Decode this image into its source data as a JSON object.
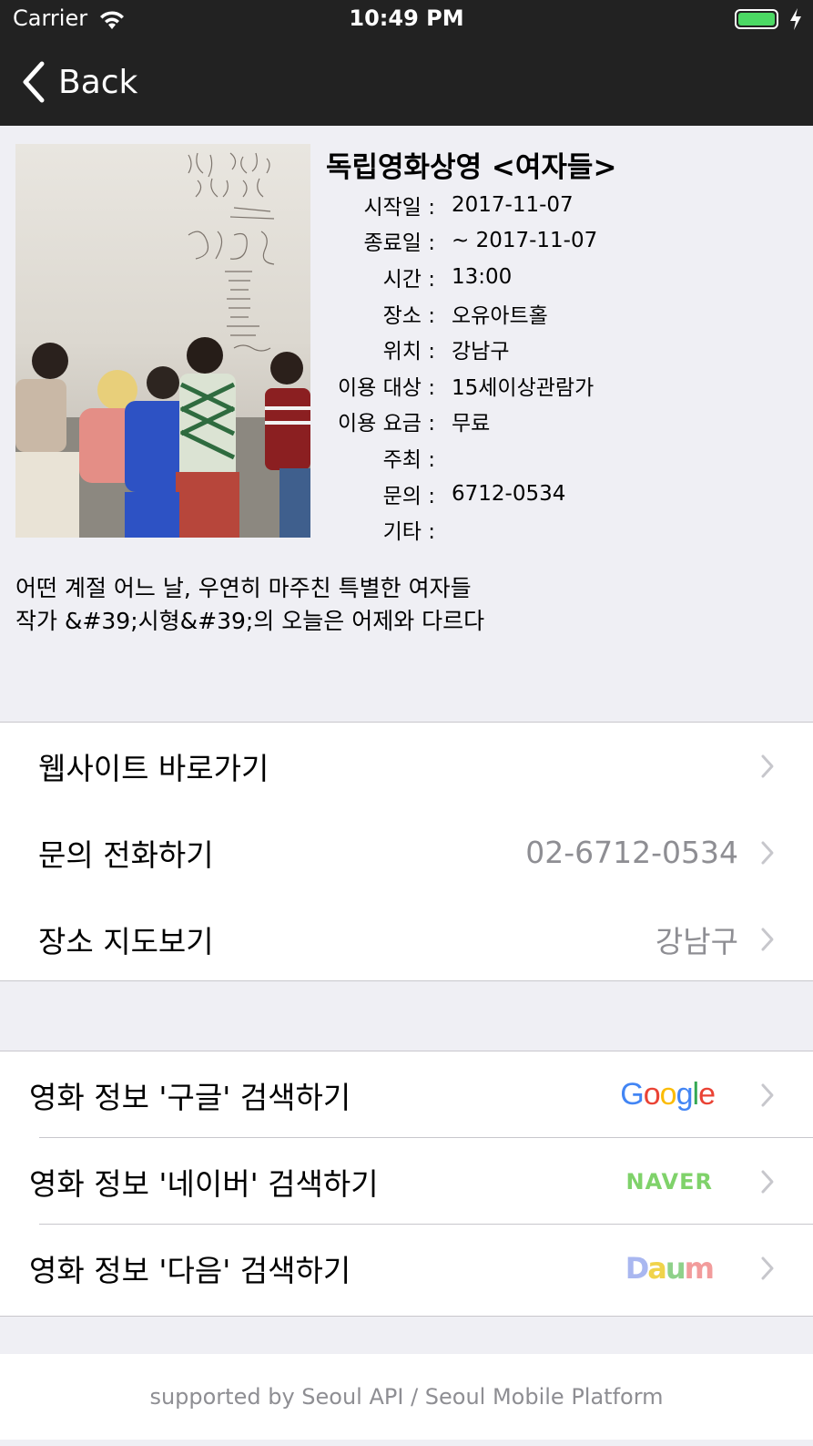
{
  "status_bar": {
    "carrier": "Carrier",
    "time": "10:49 PM",
    "battery_color": "#4cd964"
  },
  "nav": {
    "back_label": "Back",
    "back_icon": "chevron-left-icon"
  },
  "event": {
    "title": "독립영화상영 <여자들>",
    "poster_icon": "movie-poster-image",
    "info": [
      {
        "label": "시작일 :",
        "value": "2017-11-07"
      },
      {
        "label": "종료일 :",
        "value": " ~ 2017-11-07"
      },
      {
        "label": "시간 :",
        "value": "13:00"
      },
      {
        "label": "장소 :",
        "value": "오유아트홀"
      },
      {
        "label": "위치 :",
        "value": "강남구"
      },
      {
        "label": "이용 대상 :",
        "value": "15세이상관람가"
      },
      {
        "label": "이용 요금 :",
        "value": "무료"
      },
      {
        "label": "주최 :",
        "value": ""
      },
      {
        "label": "문의 :",
        "value": "6712-0534"
      },
      {
        "label": "기타 :",
        "value": ""
      }
    ],
    "description": [
      "어떤 계절 어느 날, 우연히 마주친 특별한 여자들",
      "작가 &#39;시형&#39;의 오늘은 어제와 다르다"
    ]
  },
  "actions": [
    {
      "label": "웹사이트 바로가기",
      "detail": ""
    },
    {
      "label": "문의 전화하기",
      "detail": "02-6712-0534"
    },
    {
      "label": "장소 지도보기",
      "detail": "강남구"
    }
  ],
  "search": [
    {
      "label": "영화 정보 '구글' 검색하기",
      "logo": "Google"
    },
    {
      "label": "영화 정보 '네이버' 검색하기",
      "logo": "NAVER"
    },
    {
      "label": "영화 정보 '다음' 검색하기",
      "logo": "Daum"
    }
  ],
  "footer": {
    "text": "supported by Seoul API / Seoul Mobile Platform"
  },
  "colors": {
    "nav_background": "#222222",
    "page_background": "#efeff4",
    "detail_text": "#8e8e93",
    "naver_green": "#7fd26a"
  }
}
